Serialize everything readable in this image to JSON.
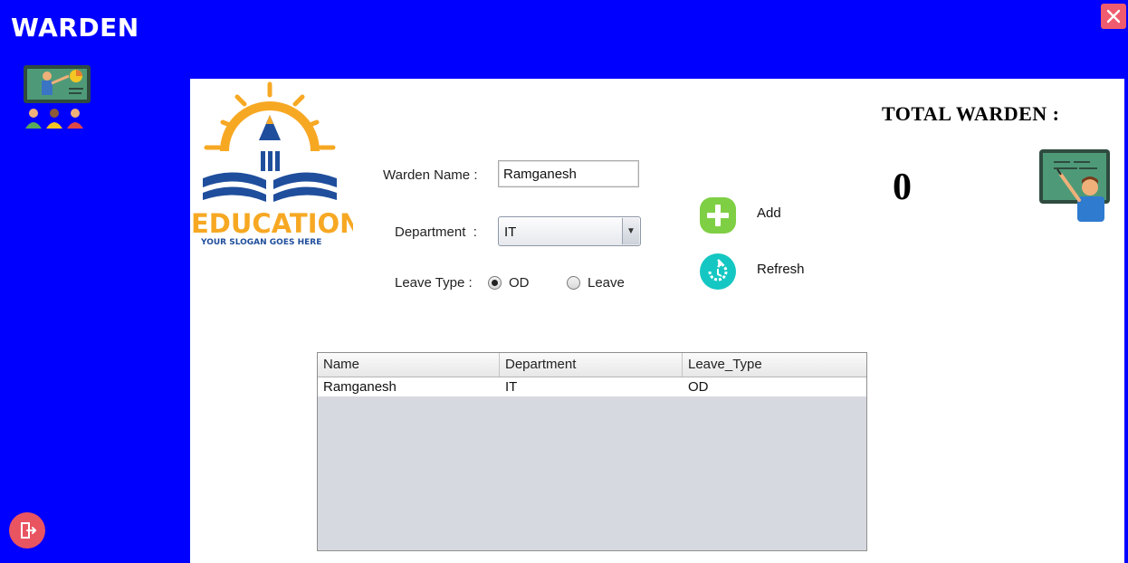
{
  "window": {
    "title": "WARDEN",
    "close_icon": "close-icon"
  },
  "sidebar": {
    "app_icon": "teacher-classroom-icon",
    "exit_icon": "exit-door-icon"
  },
  "logo": {
    "text": "EDUCATION",
    "slogan": "YOUR SLOGAN GOES HERE"
  },
  "form": {
    "warden_name_label": "Warden Name :",
    "warden_name_value": "Ramganesh",
    "department_label": "Department  :",
    "department_value": "IT",
    "leave_type_label": "Leave Type :",
    "leave_options": [
      {
        "label": "OD",
        "selected": true
      },
      {
        "label": "Leave",
        "selected": false
      }
    ]
  },
  "actions": {
    "add_label": "Add",
    "refresh_label": "Refresh"
  },
  "summary": {
    "title": "TOTAL WARDEN :",
    "count": "0",
    "icon": "teacher-board-icon"
  },
  "table": {
    "columns": [
      "Name",
      "Department",
      "Leave_Type"
    ],
    "rows": [
      [
        "Ramganesh",
        "IT",
        "OD"
      ]
    ]
  },
  "colors": {
    "background": "#0000ff",
    "panel": "#ffffff",
    "close": "#ef5b6f",
    "add": "#7fcf45",
    "refresh": "#15c7c2",
    "logo_orange": "#f7a823",
    "logo_blue": "#1f4e9c"
  }
}
